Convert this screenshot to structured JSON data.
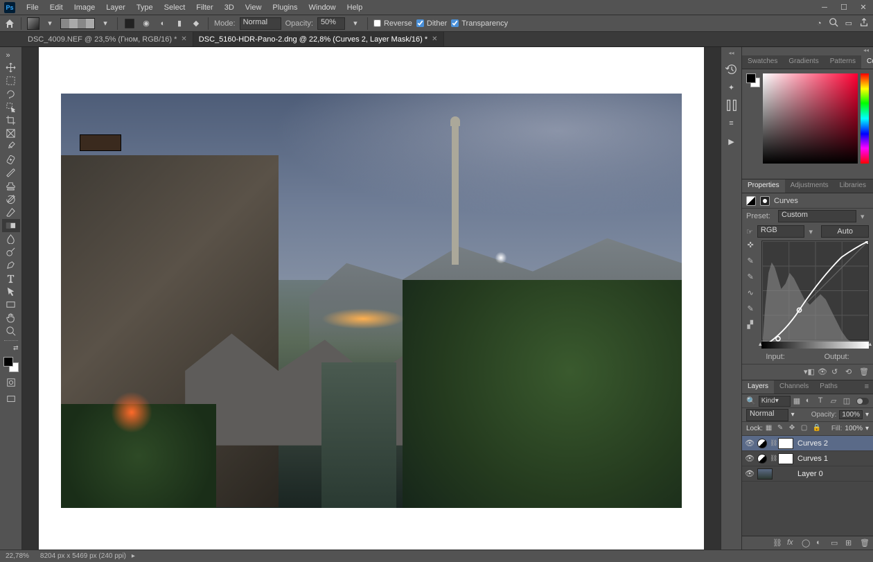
{
  "menu": {
    "items": [
      "File",
      "Edit",
      "Image",
      "Layer",
      "Type",
      "Select",
      "Filter",
      "3D",
      "View",
      "Plugins",
      "Window",
      "Help"
    ]
  },
  "optionsbar": {
    "mode_label": "Mode:",
    "mode_value": "Normal",
    "opacity_label": "Opacity:",
    "opacity_value": "50%",
    "reverse": {
      "label": "Reverse",
      "checked": false
    },
    "dither": {
      "label": "Dither",
      "checked": true
    },
    "transparency": {
      "label": "Transparency",
      "checked": true
    }
  },
  "tabs": [
    {
      "title": "DSC_4009.NEF @ 23,5% (Гном, RGB/16) *",
      "active": false
    },
    {
      "title": "DSC_5160-HDR-Pano-2.dng @ 22,8% (Curves 2, Layer Mask/16) *",
      "active": true
    }
  ],
  "toolbox": {
    "tools": [
      {
        "name": "move-tool",
        "glyph": "move"
      },
      {
        "name": "marquee-tool",
        "glyph": "marquee"
      },
      {
        "name": "lasso-tool",
        "glyph": "lasso"
      },
      {
        "name": "object-select-tool",
        "glyph": "wand"
      },
      {
        "name": "crop-tool",
        "glyph": "crop"
      },
      {
        "name": "frame-tool",
        "glyph": "frame"
      },
      {
        "name": "eyedropper-tool",
        "glyph": "eyedropper"
      },
      {
        "name": "healing-brush-tool",
        "glyph": "bandage"
      },
      {
        "name": "brush-tool",
        "glyph": "brush"
      },
      {
        "name": "clone-stamp-tool",
        "glyph": "stamp"
      },
      {
        "name": "history-brush-tool",
        "glyph": "historybrush"
      },
      {
        "name": "eraser-tool",
        "glyph": "eraser"
      },
      {
        "name": "gradient-tool",
        "glyph": "gradient",
        "selected": true
      },
      {
        "name": "blur-tool",
        "glyph": "blur"
      },
      {
        "name": "dodge-tool",
        "glyph": "dodge"
      },
      {
        "name": "pen-tool",
        "glyph": "pen"
      },
      {
        "name": "type-tool",
        "glyph": "type"
      },
      {
        "name": "path-select-tool",
        "glyph": "pathselect"
      },
      {
        "name": "rectangle-tool",
        "glyph": "shape"
      },
      {
        "name": "hand-tool",
        "glyph": "hand"
      },
      {
        "name": "zoom-tool",
        "glyph": "zoom"
      }
    ]
  },
  "ministrip_icons": [
    "history-icon",
    "actions-icon",
    "brushes-icon",
    "adjustments-icon",
    "play-icon"
  ],
  "color_panel": {
    "tabs": [
      "Swatches",
      "Gradients",
      "Patterns",
      "Color"
    ],
    "active_tab": "Color",
    "foreground": "#000000",
    "background": "#ffffff",
    "hue": 350
  },
  "properties_panel": {
    "tabs": [
      "Properties",
      "Adjustments",
      "Libraries"
    ],
    "active_tab": "Properties",
    "adjustment_type": "Curves",
    "preset_label": "Preset:",
    "preset_value": "Custom",
    "channel_value": "RGB",
    "auto_button": "Auto",
    "input_label": "Input:",
    "output_label": "Output:",
    "curve_tools": [
      "hand-target-icon",
      "eyedropper-sample-icon",
      "eyedropper-black-icon",
      "curve-smooth-icon",
      "pencil-icon",
      "histogram-icon"
    ]
  },
  "layers_panel": {
    "tabs": [
      "Layers",
      "Channels",
      "Paths"
    ],
    "active_tab": "Layers",
    "filter_kind_label": "Kind",
    "filter_icons": [
      "image-filter-icon",
      "adjustment-filter-icon",
      "type-filter-icon",
      "shape-filter-icon",
      "smartobject-filter-icon"
    ],
    "blend_mode": "Normal",
    "opacity_label": "Opacity:",
    "opacity_value": "100%",
    "lock_label": "Lock:",
    "lock_icons": [
      "lock-transparent-icon",
      "lock-brush-icon",
      "lock-move-icon",
      "lock-artboard-icon",
      "lock-all-icon"
    ],
    "fill_label": "Fill:",
    "fill_value": "100%",
    "layers": [
      {
        "name": "Curves 2",
        "type": "adjustment",
        "visible": true,
        "selected": true
      },
      {
        "name": "Curves 1",
        "type": "adjustment",
        "visible": true,
        "selected": false
      },
      {
        "name": "Layer 0",
        "type": "pixel",
        "visible": true,
        "selected": false
      }
    ],
    "footer_icons": [
      "link-icon",
      "fx-icon",
      "mask-icon",
      "adjustment-new-icon",
      "group-icon",
      "new-layer-icon",
      "trash-icon"
    ]
  },
  "statusbar": {
    "zoom": "22,78%",
    "docinfo": "8204 px x 5469 px (240 ppi)"
  }
}
